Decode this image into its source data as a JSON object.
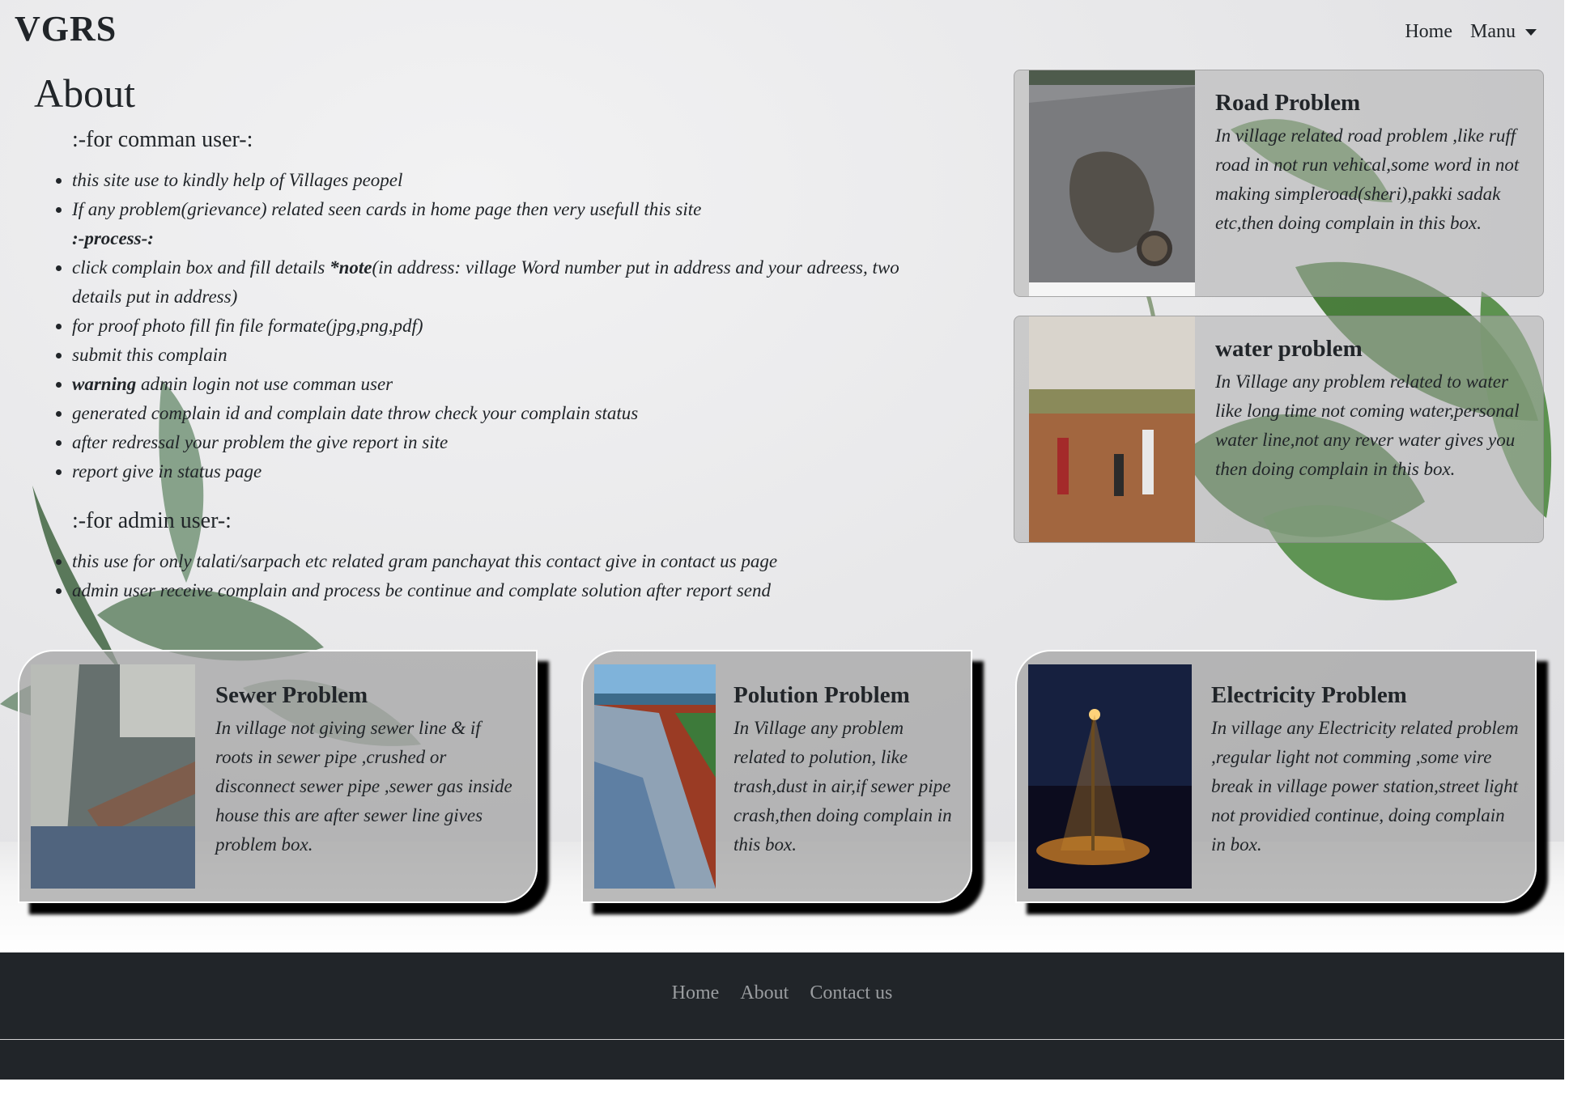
{
  "navbar": {
    "brand": "VGRS",
    "home": "Home",
    "menu": "Manu"
  },
  "about": {
    "title": "About",
    "common_user_heading": ":-for comman user-:",
    "common_items": [
      "this site use to kindly help of Villages peopel",
      "If any problem(grievance) related seen cards in home page then very usefull this site"
    ],
    "process_label": ":-process-:",
    "process_first_prefix": "click complain box and fill details ",
    "process_first_note": "*note",
    "process_first_suffix": "(in address: village Word number put in address and your adreess, two details put in address)",
    "process_items": [
      "for proof photo fill fin file formate(jpg,png,pdf)",
      "submit this complain"
    ],
    "warning_bold": "warning",
    "warning_rest": " admin login not use comman user",
    "process_items_after": [
      "generated complain id and complain date throw check your complain status",
      "after redressal your problem the give report in site",
      "report give in status page"
    ],
    "admin_heading": ":-for admin user-:",
    "admin_items": [
      "this use for only talati/sarpach etc related gram panchayat this contact give in contact us page",
      "admin user receive complain and process be continue and complate solution after report send"
    ]
  },
  "cards": {
    "road": {
      "title": "Road Problem",
      "text": "In village related road problem ,like ruff road in not run vehical,some word in not making simpleroad(sheri),pakki sadak etc,then doing complain in this box."
    },
    "water": {
      "title": "water problem",
      "text": "In Village any problem related to water like long time not coming water,personal water line,not any rever water gives you then doing complain in this box."
    },
    "sewer": {
      "title": "Sewer Problem",
      "text": "In village not giving sewer line & if roots in sewer pipe ,crushed or disconnect sewer pipe ,sewer gas inside house this are after sewer line gives problem box."
    },
    "pollution": {
      "title": "Polution Problem",
      "text": "In Village any problem related to polution, like trash,dust in air,if sewer pipe crash,then doing complain in this box."
    },
    "electricity": {
      "title": "Electricity Problem",
      "text": "In village any Electricity related problem ,regular light not comming ,some vire break in village power station,street light not providied continue, doing complain in box."
    }
  },
  "footer": {
    "home": "Home",
    "about": "About",
    "contact": "Contact us"
  }
}
